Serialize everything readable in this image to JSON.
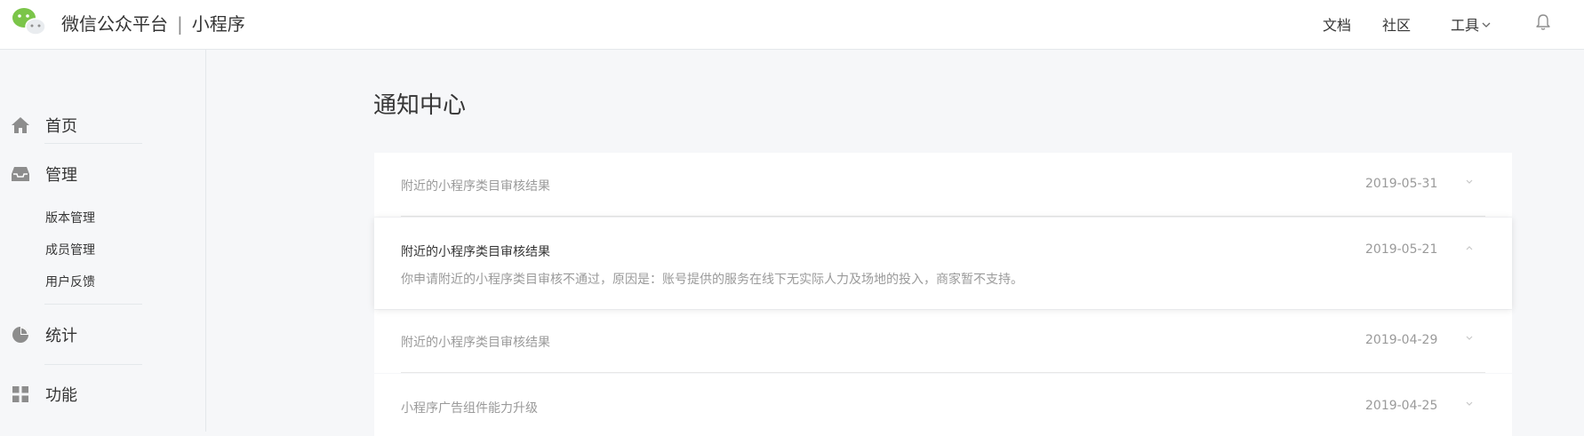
{
  "header": {
    "brand_name": "微信公众平台",
    "separator": "|",
    "product": "小程序",
    "nav": {
      "docs": "文档",
      "community": "社区",
      "tools": "工具"
    }
  },
  "sidebar": {
    "items": [
      {
        "label": "首页",
        "icon": "home-icon"
      },
      {
        "label": "管理",
        "icon": "inbox-icon",
        "subitems": [
          "版本管理",
          "成员管理",
          "用户反馈"
        ]
      },
      {
        "label": "统计",
        "icon": "pie-chart-icon"
      },
      {
        "label": "功能",
        "icon": "grid-icon"
      }
    ]
  },
  "main": {
    "title": "通知中心",
    "notices": [
      {
        "title": "附近的小程序类目审核结果",
        "date": "2019-05-31",
        "expanded": false
      },
      {
        "title": "附近的小程序类目审核结果",
        "date": "2019-05-21",
        "expanded": true,
        "body": "你申请附近的小程序类目审核不通过，原因是：账号提供的服务在线下无实际人力及场地的投入，商家暂不支持。"
      },
      {
        "title": "附近的小程序类目审核结果",
        "date": "2019-04-29",
        "expanded": false
      },
      {
        "title": "小程序广告组件能力升级",
        "date": "2019-04-25",
        "expanded": false
      }
    ]
  },
  "colors": {
    "brand_green": "#7bc549",
    "text_primary": "#353535",
    "text_secondary": "#9a9a9a",
    "background": "#f6f7f9"
  }
}
